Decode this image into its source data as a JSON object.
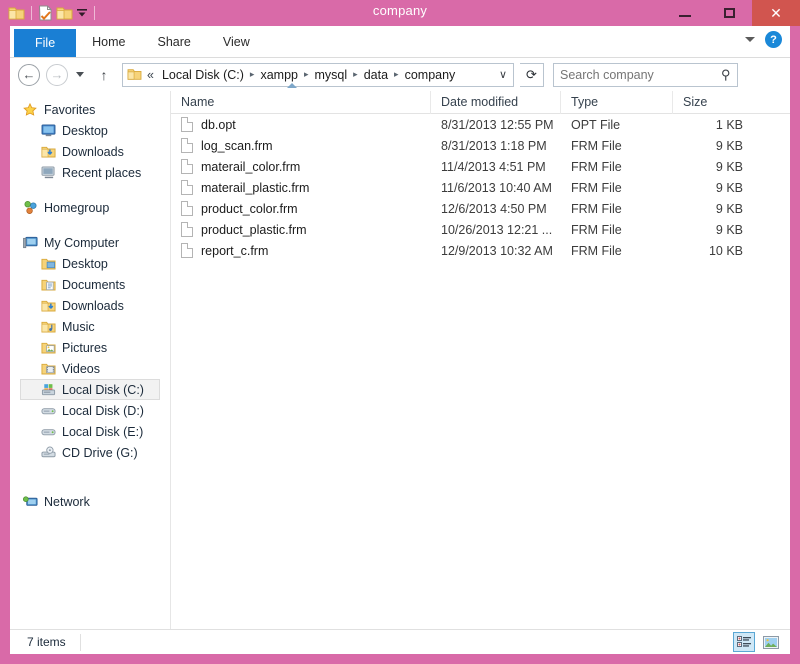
{
  "window": {
    "title": "company",
    "frame_color": "#d96aa8",
    "close_color": "#d1554f",
    "accent_blue": "#1a7fd4"
  },
  "quick_access": {
    "items": [
      {
        "name": "folder-icon",
        "label": "Folder"
      },
      {
        "name": "properties-icon",
        "label": "Properties"
      },
      {
        "name": "new-folder-icon",
        "label": "New folder"
      },
      {
        "name": "customize-dropdown-icon",
        "label": "Customize Quick Access Toolbar"
      }
    ]
  },
  "window_controls": {
    "minimize": "Minimize",
    "maximize": "Maximize",
    "close": "Close"
  },
  "ribbon": {
    "tabs": [
      {
        "label": "File",
        "active": true
      },
      {
        "label": "Home",
        "active": false
      },
      {
        "label": "Share",
        "active": false
      },
      {
        "label": "View",
        "active": false
      }
    ],
    "expand_label": "Expand the Ribbon",
    "help_label": "?"
  },
  "address_bar": {
    "back_label": "←",
    "forward_label": "→",
    "recent_label": "Recent locations",
    "up_label": "↑",
    "breadcrumb_prefix": "«",
    "crumbs": [
      "Local Disk (C:)",
      "xampp",
      "mysql",
      "data",
      "company"
    ],
    "separator": "▸",
    "dropdown": "∨",
    "refresh": "⟳"
  },
  "search": {
    "placeholder": "Search company",
    "value": "",
    "icon": "search-icon"
  },
  "nav_pane": {
    "groups": [
      {
        "header": {
          "label": "Favorites",
          "icon": "star-icon"
        },
        "items": [
          {
            "label": "Desktop",
            "icon": "desktop-icon"
          },
          {
            "label": "Downloads",
            "icon": "downloads-folder-icon"
          },
          {
            "label": "Recent places",
            "icon": "recent-places-icon"
          }
        ]
      },
      {
        "header": {
          "label": "Homegroup",
          "icon": "homegroup-icon"
        },
        "items": []
      },
      {
        "header": {
          "label": "My Computer",
          "icon": "computer-icon"
        },
        "items": [
          {
            "label": "Desktop",
            "icon": "desktop-folder-icon",
            "selected": false
          },
          {
            "label": "Documents",
            "icon": "documents-folder-icon",
            "selected": false
          },
          {
            "label": "Downloads",
            "icon": "downloads-folder-icon",
            "selected": false
          },
          {
            "label": "Music",
            "icon": "music-folder-icon",
            "selected": false
          },
          {
            "label": "Pictures",
            "icon": "pictures-folder-icon",
            "selected": false
          },
          {
            "label": "Videos",
            "icon": "videos-folder-icon",
            "selected": false
          },
          {
            "label": "Local Disk (C:)",
            "icon": "hard-drive-icon",
            "selected": true
          },
          {
            "label": "Local Disk (D:)",
            "icon": "disk-drive-icon",
            "selected": false
          },
          {
            "label": "Local Disk (E:)",
            "icon": "disk-drive-icon",
            "selected": false
          },
          {
            "label": "CD Drive (G:)",
            "icon": "cd-drive-icon",
            "selected": false
          }
        ]
      },
      {
        "header": {
          "label": "Network",
          "icon": "network-icon"
        },
        "items": []
      }
    ]
  },
  "file_list": {
    "columns": [
      {
        "key": "name",
        "label": "Name",
        "sorted": "asc"
      },
      {
        "key": "date",
        "label": "Date modified",
        "sorted": null
      },
      {
        "key": "type",
        "label": "Type",
        "sorted": null
      },
      {
        "key": "size",
        "label": "Size",
        "sorted": null
      }
    ],
    "rows": [
      {
        "name": "db.opt",
        "date": "8/31/2013 12:55 PM",
        "type": "OPT File",
        "size": "1 KB",
        "icon": "file-icon"
      },
      {
        "name": "log_scan.frm",
        "date": "8/31/2013 1:18 PM",
        "type": "FRM File",
        "size": "9 KB",
        "icon": "file-icon"
      },
      {
        "name": "materail_color.frm",
        "date": "11/4/2013 4:51 PM",
        "type": "FRM File",
        "size": "9 KB",
        "icon": "file-icon"
      },
      {
        "name": "materail_plastic.frm",
        "date": "11/6/2013 10:40 AM",
        "type": "FRM File",
        "size": "9 KB",
        "icon": "file-icon"
      },
      {
        "name": "product_color.frm",
        "date": "12/6/2013 4:50 PM",
        "type": "FRM File",
        "size": "9 KB",
        "icon": "file-icon"
      },
      {
        "name": "product_plastic.frm",
        "date": "10/26/2013 12:21 ...",
        "type": "FRM File",
        "size": "9 KB",
        "icon": "file-icon"
      },
      {
        "name": "report_c.frm",
        "date": "12/9/2013 10:32 AM",
        "type": "FRM File",
        "size": "10 KB",
        "icon": "file-icon"
      }
    ]
  },
  "status_bar": {
    "item_count": "7 items",
    "views": [
      {
        "name": "details-view-button",
        "label": "Details view",
        "active": true
      },
      {
        "name": "large-icons-view-button",
        "label": "Large icons view",
        "active": false
      }
    ]
  }
}
